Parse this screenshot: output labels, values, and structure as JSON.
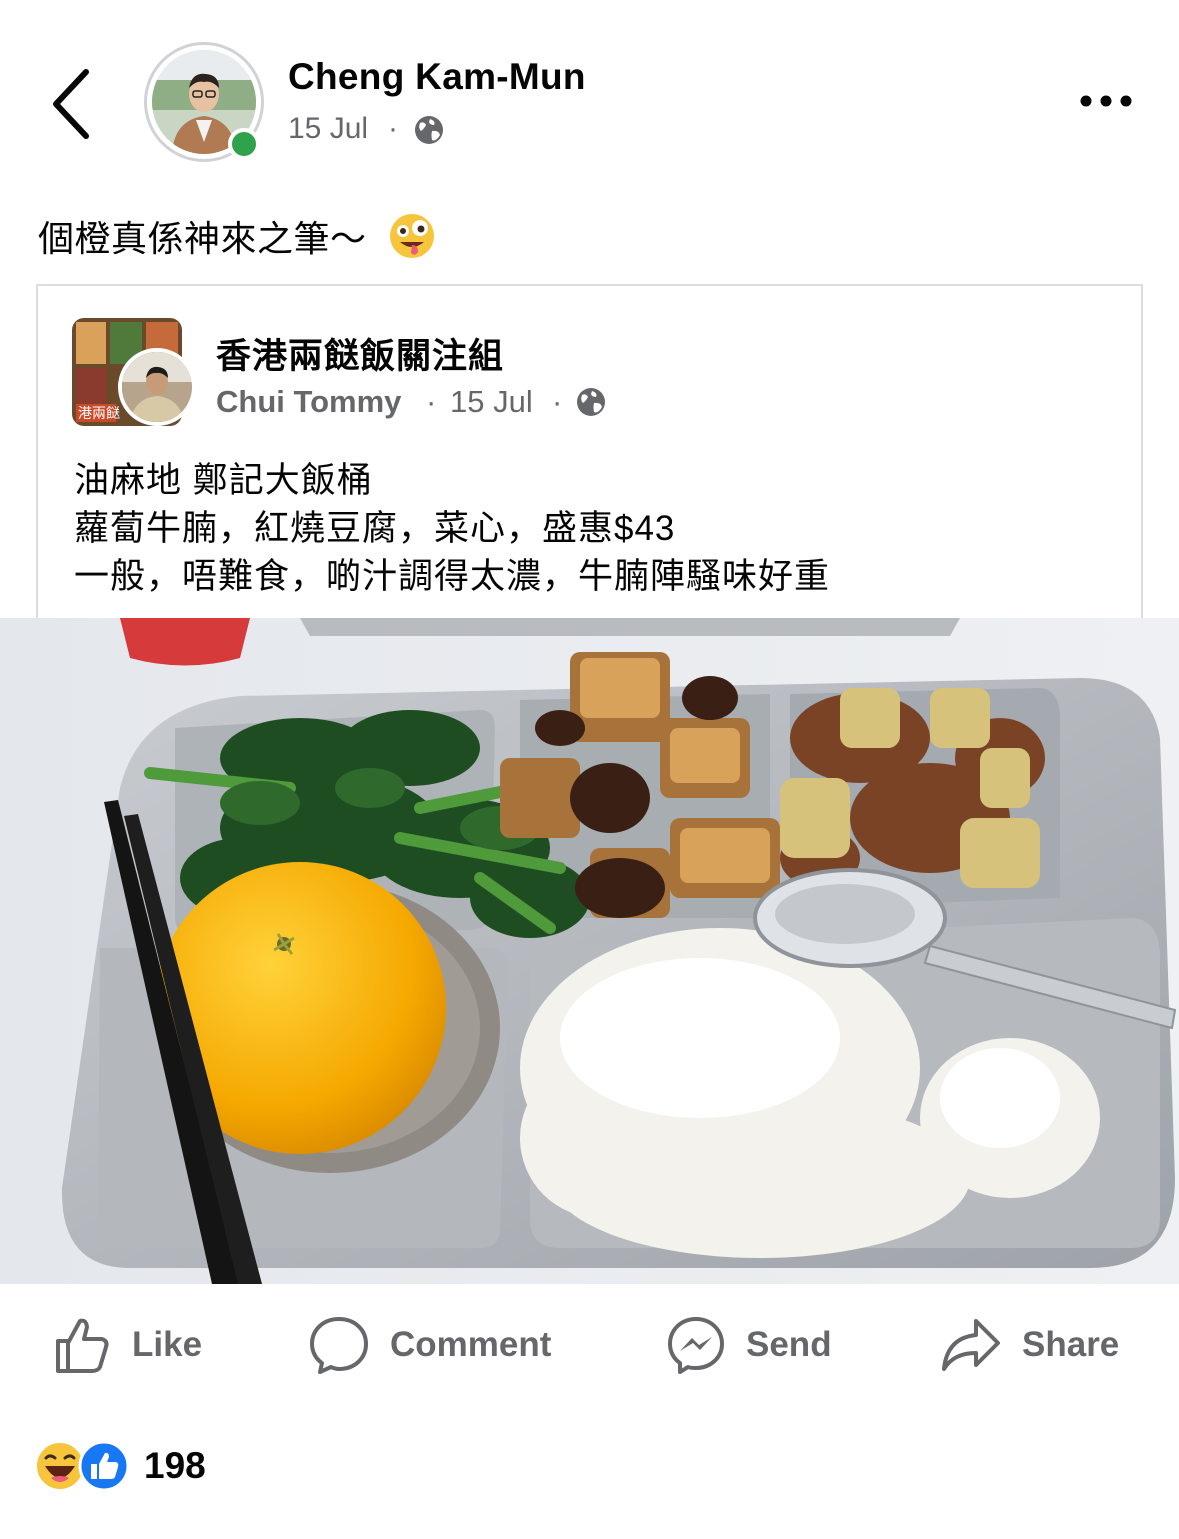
{
  "header": {
    "author_name": "Cheng Kam-Mun",
    "post_date": "15 Jul",
    "separator": "·",
    "privacy_icon": "globe-icon",
    "back_icon": "chevron-left-icon",
    "more_icon": "more-horizontal-icon"
  },
  "post": {
    "text": "個橙真係神來之筆～",
    "emoji": "zany-face-emoji"
  },
  "shared_post": {
    "group_name": "香港兩餸飯關注組",
    "author": "Chui Tommy",
    "separator": "·",
    "date": "15 Jul",
    "privacy_icon": "globe-icon",
    "lines": [
      "油麻地 鄭記大飯桶",
      "蘿蔔牛腩，紅燒豆腐，菜心，盛惠$43",
      "一般，唔難食，啲汁調得太濃，牛腩陣騷味好重"
    ]
  },
  "actions": {
    "like": "Like",
    "comment": "Comment",
    "send": "Send",
    "share": "Share"
  },
  "reactions": {
    "types": [
      "haha",
      "like"
    ],
    "count": "198"
  },
  "colors": {
    "online": "#31a24c",
    "secondary_text": "#65676b",
    "like_blue": "#1877f2",
    "orange": "#f5a800"
  }
}
